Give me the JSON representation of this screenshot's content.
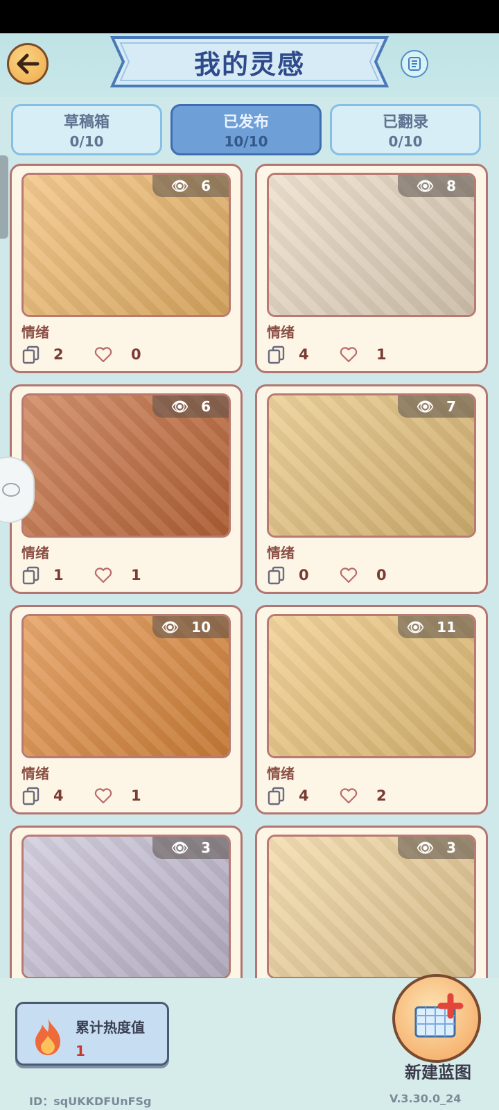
{
  "header": {
    "title": "我的灵感"
  },
  "tabs": [
    {
      "label": "草稿箱",
      "count": "0/10",
      "active": false
    },
    {
      "label": "已发布",
      "count": "10/10",
      "active": true
    },
    {
      "label": "已翻录",
      "count": "0/10",
      "active": false
    }
  ],
  "cards": [
    {
      "views": "6",
      "title": "情绪",
      "copies": "2",
      "likes": "0",
      "bg": "#f0b869"
    },
    {
      "views": "8",
      "title": "情绪",
      "copies": "4",
      "likes": "1",
      "bg": "#e9d8c0"
    },
    {
      "views": "6",
      "title": "情绪",
      "copies": "1",
      "likes": "1",
      "bg": "#c46a3a"
    },
    {
      "views": "7",
      "title": "情绪",
      "copies": "0",
      "likes": "0",
      "bg": "#e7c27a"
    },
    {
      "views": "10",
      "title": "情绪",
      "copies": "4",
      "likes": "1",
      "bg": "#e08a3c"
    },
    {
      "views": "11",
      "title": "情绪",
      "copies": "4",
      "likes": "2",
      "bg": "#eec67a"
    },
    {
      "views": "3",
      "title": "",
      "copies": "",
      "likes": "",
      "bg": "#c7c0d6"
    },
    {
      "views": "3",
      "title": "",
      "copies": "",
      "likes": "",
      "bg": "#f1d39a"
    }
  ],
  "heat": {
    "label": "累计热度值",
    "value": "1"
  },
  "new_blueprint": {
    "label": "新建蓝图"
  },
  "footer": {
    "user_id": "ID：sqUKKDFUnFSg",
    "version": "V.3.30.0_24"
  },
  "colors": {
    "accent": "#6e9fd6",
    "card_border": "#b37571",
    "title_blue": "#2e4a8a"
  }
}
